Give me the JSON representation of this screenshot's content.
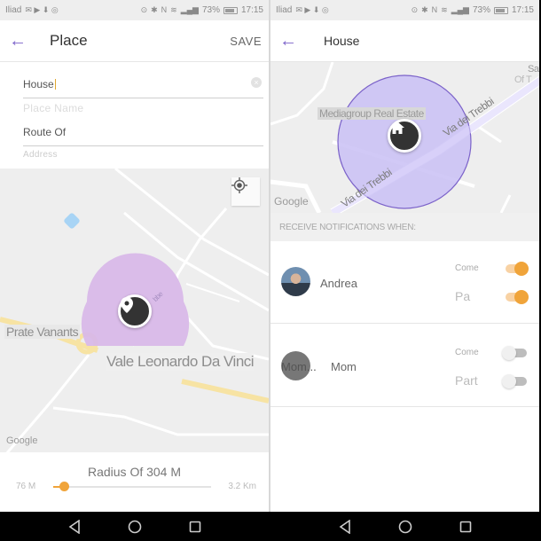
{
  "status_bar": {
    "carrier": "Iliad",
    "battery": "73%",
    "time": "17:15"
  },
  "left_screen": {
    "header": {
      "title": "Place",
      "save_label": "SAVE"
    },
    "form": {
      "name_value": "House",
      "name_placeholder": "Place Name",
      "address_value": "Route Of",
      "address_placeholder": "Address"
    },
    "map": {
      "labels": {
        "street_1": "Prate Vanants",
        "street_2": "Vale Leonardo Da Vinci",
        "road_mark": "bbe",
        "attribution": "Google"
      },
      "circle_color": "#d8b8e8"
    },
    "radius": {
      "title": "Radius Of 304 M",
      "min_label": "76 M",
      "max_label": "3.2 Km",
      "value_fraction": 0.07
    }
  },
  "right_screen": {
    "header": {
      "title": "House"
    },
    "map": {
      "labels": {
        "poi": "Mediagroup Real Estate",
        "street_1": "Via dei Trebbi",
        "street_2": "Via dei Trebbi",
        "corner_1": "Sa",
        "corner_2": "Of T",
        "attribution": "Google"
      },
      "circle_color": "#c9bff5"
    },
    "notifications": {
      "header": "RECEIVE NOTIFICATIONS WHEN:",
      "people": [
        {
          "name": "Andrea",
          "arrive_label": "Come",
          "arrive_on": true,
          "leave_label": "Pa",
          "leave_on": true
        },
        {
          "avatar_text": "Mom...",
          "name": "Mom",
          "arrive_label": "Come",
          "arrive_on": false,
          "leave_label": "Part",
          "leave_on": false
        }
      ]
    }
  },
  "colors": {
    "accent_purple": "#7b62c9",
    "accent_orange": "#f0a43a"
  }
}
